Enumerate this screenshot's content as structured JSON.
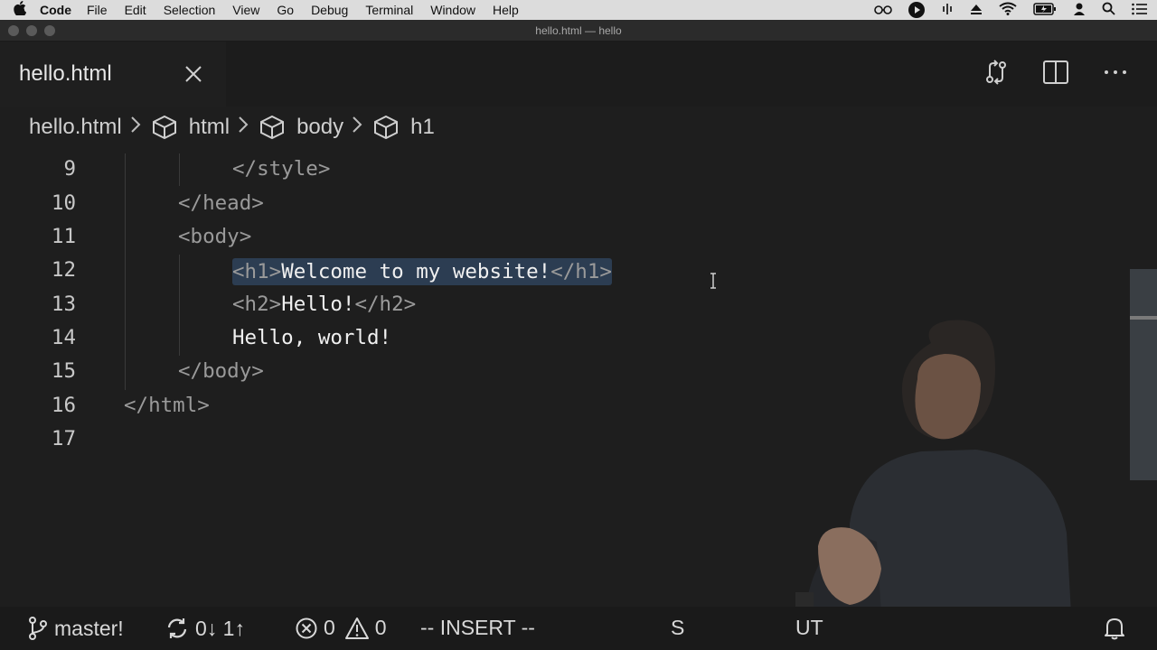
{
  "menubar": {
    "apple": "",
    "app_name": "Code",
    "menus": [
      "File",
      "Edit",
      "Selection",
      "View",
      "Go",
      "Debug",
      "Terminal",
      "Window",
      "Help"
    ]
  },
  "window": {
    "title": "hello.html — hello"
  },
  "tab": {
    "label": "hello.html"
  },
  "breadcrumb": {
    "file": "hello.html",
    "items": [
      "html",
      "body",
      "h1"
    ]
  },
  "editor": {
    "lines": [
      {
        "num": "9",
        "open": "</style>",
        "text": "",
        "close": ""
      },
      {
        "num": "10",
        "open": "</head>",
        "text": "",
        "close": ""
      },
      {
        "num": "11",
        "open": "<body>",
        "text": "",
        "close": ""
      },
      {
        "num": "12",
        "open": "<h1>",
        "text": "Welcome to my website!",
        "close": "</h1>"
      },
      {
        "num": "13",
        "open": "<h2>",
        "text": "Hello!",
        "close": "</h2>"
      },
      {
        "num": "14",
        "open": "",
        "text": "Hello, world!",
        "close": ""
      },
      {
        "num": "15",
        "open": "</body>",
        "text": "",
        "close": ""
      },
      {
        "num": "16",
        "open": "</html>",
        "text": "",
        "close": ""
      },
      {
        "num": "17",
        "open": "",
        "text": "",
        "close": ""
      }
    ]
  },
  "statusbar": {
    "branch": "master!",
    "sync": "0↓ 1↑",
    "errors": "0",
    "warnings": "0",
    "mode": "-- INSERT --",
    "partial_a": "S",
    "partial_b": "UT"
  },
  "colors": {
    "selection": "#2c3d52",
    "menubar": "#dcdcdc",
    "editor_bg": "#1e1e1e"
  }
}
